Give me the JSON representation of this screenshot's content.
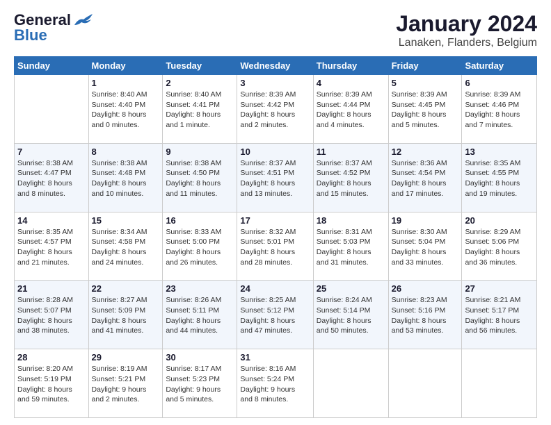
{
  "header": {
    "logo_line1": "General",
    "logo_line2": "Blue",
    "title": "January 2024",
    "subtitle": "Lanaken, Flanders, Belgium"
  },
  "days_of_week": [
    "Sunday",
    "Monday",
    "Tuesday",
    "Wednesday",
    "Thursday",
    "Friday",
    "Saturday"
  ],
  "weeks": [
    [
      {
        "day": "",
        "info": ""
      },
      {
        "day": "1",
        "info": "Sunrise: 8:40 AM\nSunset: 4:40 PM\nDaylight: 8 hours\nand 0 minutes."
      },
      {
        "day": "2",
        "info": "Sunrise: 8:40 AM\nSunset: 4:41 PM\nDaylight: 8 hours\nand 1 minute."
      },
      {
        "day": "3",
        "info": "Sunrise: 8:39 AM\nSunset: 4:42 PM\nDaylight: 8 hours\nand 2 minutes."
      },
      {
        "day": "4",
        "info": "Sunrise: 8:39 AM\nSunset: 4:44 PM\nDaylight: 8 hours\nand 4 minutes."
      },
      {
        "day": "5",
        "info": "Sunrise: 8:39 AM\nSunset: 4:45 PM\nDaylight: 8 hours\nand 5 minutes."
      },
      {
        "day": "6",
        "info": "Sunrise: 8:39 AM\nSunset: 4:46 PM\nDaylight: 8 hours\nand 7 minutes."
      }
    ],
    [
      {
        "day": "7",
        "info": "Sunrise: 8:38 AM\nSunset: 4:47 PM\nDaylight: 8 hours\nand 8 minutes."
      },
      {
        "day": "8",
        "info": "Sunrise: 8:38 AM\nSunset: 4:48 PM\nDaylight: 8 hours\nand 10 minutes."
      },
      {
        "day": "9",
        "info": "Sunrise: 8:38 AM\nSunset: 4:50 PM\nDaylight: 8 hours\nand 11 minutes."
      },
      {
        "day": "10",
        "info": "Sunrise: 8:37 AM\nSunset: 4:51 PM\nDaylight: 8 hours\nand 13 minutes."
      },
      {
        "day": "11",
        "info": "Sunrise: 8:37 AM\nSunset: 4:52 PM\nDaylight: 8 hours\nand 15 minutes."
      },
      {
        "day": "12",
        "info": "Sunrise: 8:36 AM\nSunset: 4:54 PM\nDaylight: 8 hours\nand 17 minutes."
      },
      {
        "day": "13",
        "info": "Sunrise: 8:35 AM\nSunset: 4:55 PM\nDaylight: 8 hours\nand 19 minutes."
      }
    ],
    [
      {
        "day": "14",
        "info": "Sunrise: 8:35 AM\nSunset: 4:57 PM\nDaylight: 8 hours\nand 21 minutes."
      },
      {
        "day": "15",
        "info": "Sunrise: 8:34 AM\nSunset: 4:58 PM\nDaylight: 8 hours\nand 24 minutes."
      },
      {
        "day": "16",
        "info": "Sunrise: 8:33 AM\nSunset: 5:00 PM\nDaylight: 8 hours\nand 26 minutes."
      },
      {
        "day": "17",
        "info": "Sunrise: 8:32 AM\nSunset: 5:01 PM\nDaylight: 8 hours\nand 28 minutes."
      },
      {
        "day": "18",
        "info": "Sunrise: 8:31 AM\nSunset: 5:03 PM\nDaylight: 8 hours\nand 31 minutes."
      },
      {
        "day": "19",
        "info": "Sunrise: 8:30 AM\nSunset: 5:04 PM\nDaylight: 8 hours\nand 33 minutes."
      },
      {
        "day": "20",
        "info": "Sunrise: 8:29 AM\nSunset: 5:06 PM\nDaylight: 8 hours\nand 36 minutes."
      }
    ],
    [
      {
        "day": "21",
        "info": "Sunrise: 8:28 AM\nSunset: 5:07 PM\nDaylight: 8 hours\nand 38 minutes."
      },
      {
        "day": "22",
        "info": "Sunrise: 8:27 AM\nSunset: 5:09 PM\nDaylight: 8 hours\nand 41 minutes."
      },
      {
        "day": "23",
        "info": "Sunrise: 8:26 AM\nSunset: 5:11 PM\nDaylight: 8 hours\nand 44 minutes."
      },
      {
        "day": "24",
        "info": "Sunrise: 8:25 AM\nSunset: 5:12 PM\nDaylight: 8 hours\nand 47 minutes."
      },
      {
        "day": "25",
        "info": "Sunrise: 8:24 AM\nSunset: 5:14 PM\nDaylight: 8 hours\nand 50 minutes."
      },
      {
        "day": "26",
        "info": "Sunrise: 8:23 AM\nSunset: 5:16 PM\nDaylight: 8 hours\nand 53 minutes."
      },
      {
        "day": "27",
        "info": "Sunrise: 8:21 AM\nSunset: 5:17 PM\nDaylight: 8 hours\nand 56 minutes."
      }
    ],
    [
      {
        "day": "28",
        "info": "Sunrise: 8:20 AM\nSunset: 5:19 PM\nDaylight: 8 hours\nand 59 minutes."
      },
      {
        "day": "29",
        "info": "Sunrise: 8:19 AM\nSunset: 5:21 PM\nDaylight: 9 hours\nand 2 minutes."
      },
      {
        "day": "30",
        "info": "Sunrise: 8:17 AM\nSunset: 5:23 PM\nDaylight: 9 hours\nand 5 minutes."
      },
      {
        "day": "31",
        "info": "Sunrise: 8:16 AM\nSunset: 5:24 PM\nDaylight: 9 hours\nand 8 minutes."
      },
      {
        "day": "",
        "info": ""
      },
      {
        "day": "",
        "info": ""
      },
      {
        "day": "",
        "info": ""
      }
    ]
  ]
}
